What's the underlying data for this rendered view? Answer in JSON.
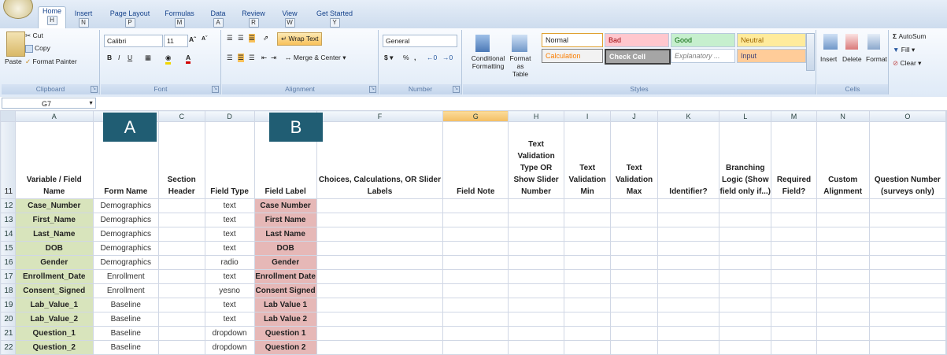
{
  "tabs": [
    {
      "label": "Home",
      "key": "H",
      "active": true
    },
    {
      "label": "Insert",
      "key": "N"
    },
    {
      "label": "Page Layout",
      "key": "P"
    },
    {
      "label": "Formulas",
      "key": "M"
    },
    {
      "label": "Data",
      "key": "A"
    },
    {
      "label": "Review",
      "key": "R"
    },
    {
      "label": "View",
      "key": "W"
    },
    {
      "label": "Get Started",
      "key": "Y"
    }
  ],
  "clipboard": {
    "paste": "Paste",
    "cut": "Cut",
    "copy": "Copy",
    "format_painter": "Format Painter",
    "label": "Clipboard"
  },
  "font": {
    "name": "Calibri",
    "size": "11",
    "label": "Font"
  },
  "alignment": {
    "wrap": "Wrap Text",
    "merge": "Merge & Center",
    "label": "Alignment"
  },
  "number": {
    "format": "General",
    "label": "Number",
    "currency": "$",
    "percent": "%",
    "comma": ","
  },
  "styles": {
    "conditional": "Conditional Formatting",
    "format_table": "Format as Table",
    "normal": "Normal",
    "bad": "Bad",
    "good": "Good",
    "neutral": "Neutral",
    "calculation": "Calculation",
    "check_cell": "Check Cell",
    "explanatory": "Explanatory ...",
    "input": "Input",
    "label": "Styles"
  },
  "cells": {
    "insert": "Insert",
    "delete": "Delete",
    "format": "Format",
    "label": "Cells"
  },
  "editing": {
    "autosum": "AutoSum",
    "fill": "Fill",
    "clear": "Clear"
  },
  "namebox": "G7",
  "markers": {
    "a": "A",
    "b": "B"
  },
  "columns": [
    "A",
    "B",
    "C",
    "D",
    "E",
    "F",
    "G",
    "H",
    "I",
    "J",
    "K",
    "L",
    "M",
    "N",
    "O"
  ],
  "header_row": {
    "num": "11",
    "cells": [
      "Variable / Field Name",
      "Form Name",
      "Section Header",
      "Field Type",
      "Field Label",
      "Choices, Calculations, OR Slider Labels",
      "Field Note",
      "Text Validation Type OR Show Slider Number",
      "Text Validation Min",
      "Text Validation Max",
      "Identifier?",
      "Branching Logic (Show field only if...)",
      "Required Field?",
      "Custom Alignment",
      "Question Number (surveys only)"
    ]
  },
  "rows": [
    {
      "num": "12",
      "var": "Case_Number",
      "form": "Demographics",
      "type": "text",
      "label": "Case Number"
    },
    {
      "num": "13",
      "var": "First_Name",
      "form": "Demographics",
      "type": "text",
      "label": "First Name"
    },
    {
      "num": "14",
      "var": "Last_Name",
      "form": "Demographics",
      "type": "text",
      "label": "Last Name"
    },
    {
      "num": "15",
      "var": "DOB",
      "form": "Demographics",
      "type": "text",
      "label": "DOB"
    },
    {
      "num": "16",
      "var": "Gender",
      "form": "Demographics",
      "type": "radio",
      "label": "Gender"
    },
    {
      "num": "17",
      "var": "Enrollment_Date",
      "form": "Enrollment",
      "type": "text",
      "label": "Enrollment Date"
    },
    {
      "num": "18",
      "var": "Consent_Signed",
      "form": "Enrollment",
      "type": "yesno",
      "label": "Consent Signed"
    },
    {
      "num": "19",
      "var": "Lab_Value_1",
      "form": "Baseline",
      "type": "text",
      "label": "Lab Value 1"
    },
    {
      "num": "20",
      "var": "Lab_Value_2",
      "form": "Baseline",
      "type": "text",
      "label": "Lab Value 2"
    },
    {
      "num": "21",
      "var": "Question_1",
      "form": "Baseline",
      "type": "dropdown",
      "label": "Question 1"
    },
    {
      "num": "22",
      "var": "Question_2",
      "form": "Baseline",
      "type": "dropdown",
      "label": "Question 2"
    }
  ]
}
